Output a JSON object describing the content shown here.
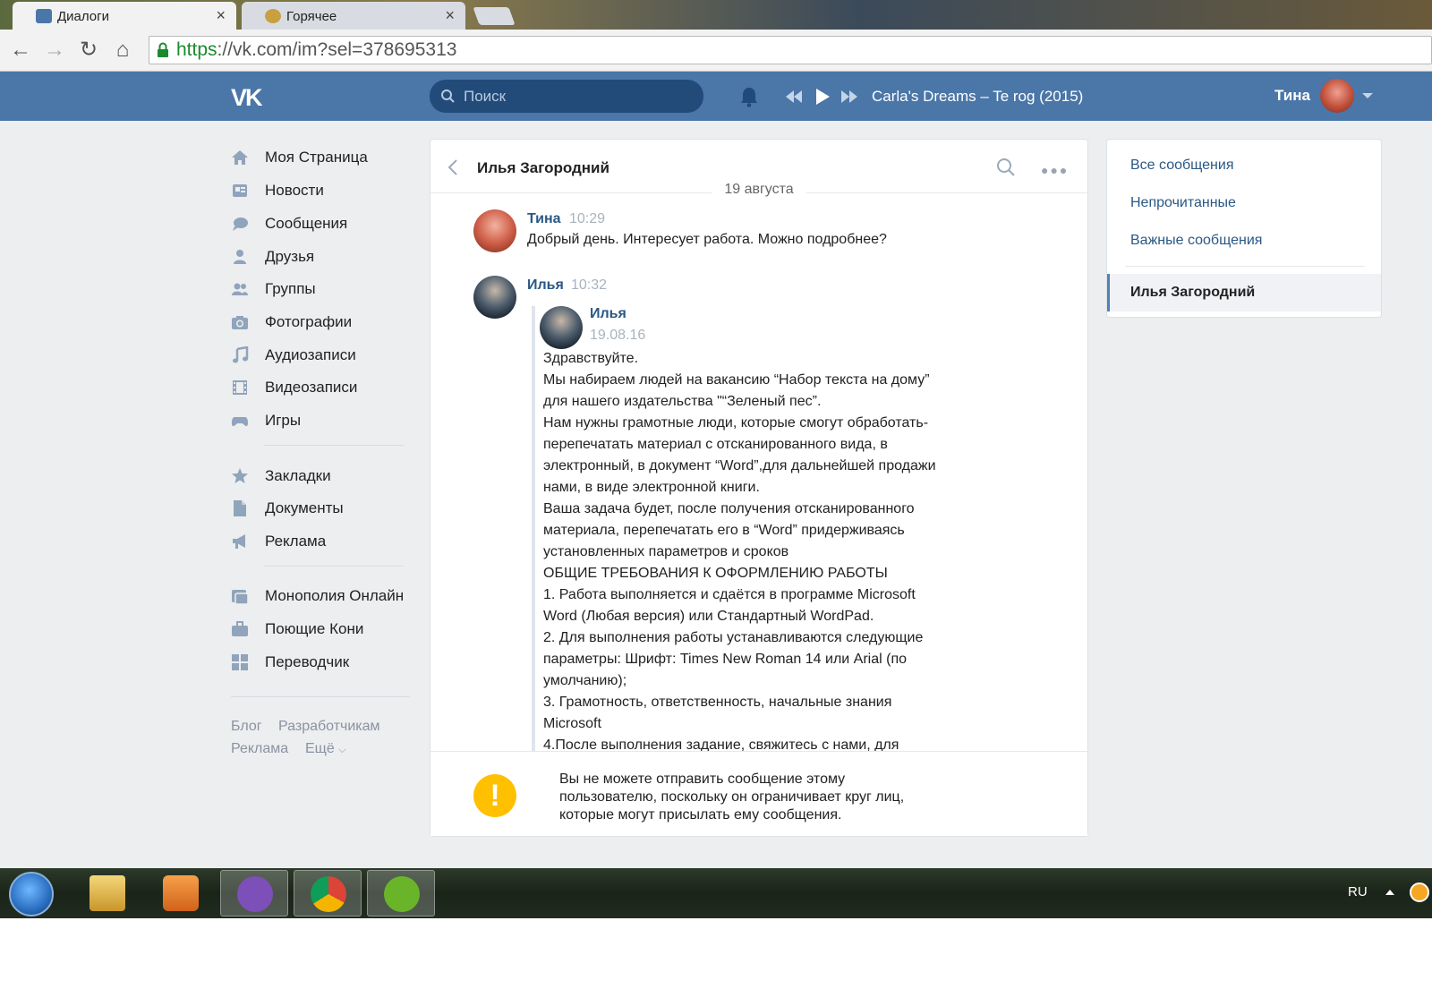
{
  "browser": {
    "tabs": [
      {
        "label": "Диалоги",
        "active": true
      },
      {
        "label": "Горячее",
        "active": false
      }
    ],
    "url_scheme": "https",
    "url_rest": "://vk.com/im?sel=378695313"
  },
  "header": {
    "logo": "VK",
    "search_placeholder": "Поиск",
    "track": "Carla's Dreams – Te rog (2015)",
    "username": "Тина"
  },
  "nav": {
    "items": [
      {
        "label": "Моя Страница",
        "icon": "home-icon"
      },
      {
        "label": "Новости",
        "icon": "news-icon"
      },
      {
        "label": "Сообщения",
        "icon": "messages-icon"
      },
      {
        "label": "Друзья",
        "icon": "friends-icon"
      },
      {
        "label": "Группы",
        "icon": "groups-icon"
      },
      {
        "label": "Фотографии",
        "icon": "camera-icon"
      },
      {
        "label": "Аудиозаписи",
        "icon": "music-icon"
      },
      {
        "label": "Видеозаписи",
        "icon": "video-icon"
      },
      {
        "label": "Игры",
        "icon": "gamepad-icon"
      }
    ],
    "items2": [
      {
        "label": "Закладки",
        "icon": "star-icon"
      },
      {
        "label": "Документы",
        "icon": "document-icon"
      },
      {
        "label": "Реклама",
        "icon": "megaphone-icon"
      }
    ],
    "apps": [
      {
        "label": "Монополия Онлайн",
        "icon": "app-monopoly-icon"
      },
      {
        "label": "Поющие Кони",
        "icon": "app-briefcase-icon"
      },
      {
        "label": "Переводчик",
        "icon": "app-grid-icon"
      }
    ],
    "footer": {
      "blog": "Блог",
      "dev": "Разработчикам",
      "ads": "Реклама",
      "more": "Ещё"
    }
  },
  "chat": {
    "title": "Илья Загородний",
    "date": "19 августа",
    "messages": [
      {
        "author": "Тина",
        "time": "10:29",
        "text": "Добрый день. Интересует работа. Можно подробнее?"
      },
      {
        "author": "Илья",
        "time": "10:32"
      }
    ],
    "forwarded": {
      "author": "Илья",
      "date": "19.08.16",
      "lines": [
        "Здравствуйте.",
        "Мы набираем людей на вакансию “Набор текста на дому”",
        "для нашего издательства \"“Зеленый пес”.",
        "Нам нужны грамотные люди, которые смогут обработать-",
        "перепечатать материал с отсканированного вида, в",
        "электронный, в документ “Word”,для дальнейшей продажи",
        "нами, в виде электронной книги.",
        "Ваша задача будет, после получения отсканированного",
        "материала, перепечатать его в “Word” придерживаясь",
        "установленных параметров и сроков",
        "ОБЩИЕ ТРЕБОВАНИЯ К ОФОРМЛЕНИЮ РАБОТЫ",
        "1. Работа выполняется и сдаётся в программе Microsoft",
        "Word (Любая версия) или Стандартный WordPad.",
        "2. Для выполнения работы устанавливаются следующие",
        "параметры: Шрифт: Times New Roman 14 или Arial (по",
        "умолчанию);",
        "3. Грамотность, ответственность, начальные знания",
        "Microsoft",
        "4.После выполнения задание, свяжитесь с нами, для"
      ]
    },
    "notice": [
      "Вы не можете отправить сообщение этому",
      "пользователю, поскольку он ограничивает круг лиц,",
      "которые могут присылать ему сообщения."
    ]
  },
  "right_panel": {
    "all": "Все сообщения",
    "unread": "Непрочитанные",
    "important": "Важные сообщения",
    "active_dialog": "Илья Загородний"
  },
  "taskbar": {
    "lang": "RU"
  },
  "colors": {
    "vk_blue": "#4a76a8",
    "link": "#2a5885",
    "warning": "#ffc000"
  }
}
